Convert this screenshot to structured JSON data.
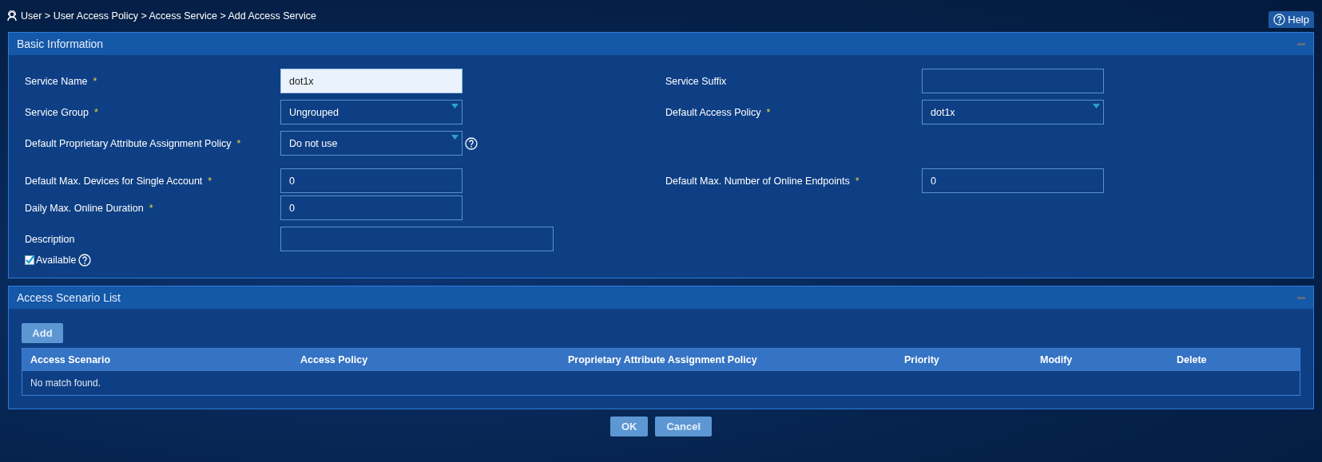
{
  "breadcrumb": "User > User Access Policy > Access Service > Add Access Service",
  "help_button": "Help",
  "basic_panel": {
    "title": "Basic Information",
    "rows": [
      {
        "left": {
          "label": "Service Name",
          "required_mark": "*",
          "kind": "text",
          "value": "dot1x",
          "focused": true
        },
        "right": {
          "label": "Service Suffix",
          "kind": "text",
          "focused": false
        }
      },
      {
        "left": {
          "label": "Service Group",
          "required_mark": "*",
          "kind": "select",
          "value": "Ungrouped",
          "focused": false
        },
        "right": {
          "label": "Default Access Policy",
          "required_mark": "*",
          "kind": "select",
          "value": "dot1x",
          "focused": false
        }
      },
      {
        "left": {
          "label": "Default Proprietary Attribute Assignment Policy",
          "required_mark": "*",
          "kind": "select",
          "value": "Do not use",
          "focused": false,
          "help": true
        }
      },
      {
        "left": {
          "label": "Default Max. Devices for Single Account",
          "required_mark": "*",
          "kind": "text",
          "value": "0",
          "focused": false
        },
        "right": {
          "label": "Default Max. Number of Online Endpoints",
          "required_mark": "*",
          "kind": "text",
          "value": "0",
          "focused": false
        }
      },
      {
        "left": {
          "label": "Daily Max. Online Duration",
          "required_mark": "*",
          "kind": "text",
          "value": "0",
          "focused": false
        }
      },
      {
        "left": {
          "label": "Description",
          "kind": "text",
          "focused": false
        }
      }
    ],
    "available": {
      "label": "Available",
      "checked": true
    }
  },
  "scenario_panel": {
    "title": "Access Scenario List",
    "add_button": "Add",
    "table": {
      "columns": [
        "Access Scenario",
        "Access Policy",
        "Proprietary Attribute Assignment Policy",
        "Priority",
        "Modify",
        "Delete"
      ],
      "empty_text": "No match found."
    }
  },
  "buttons": [
    "OK",
    "Cancel"
  ]
}
